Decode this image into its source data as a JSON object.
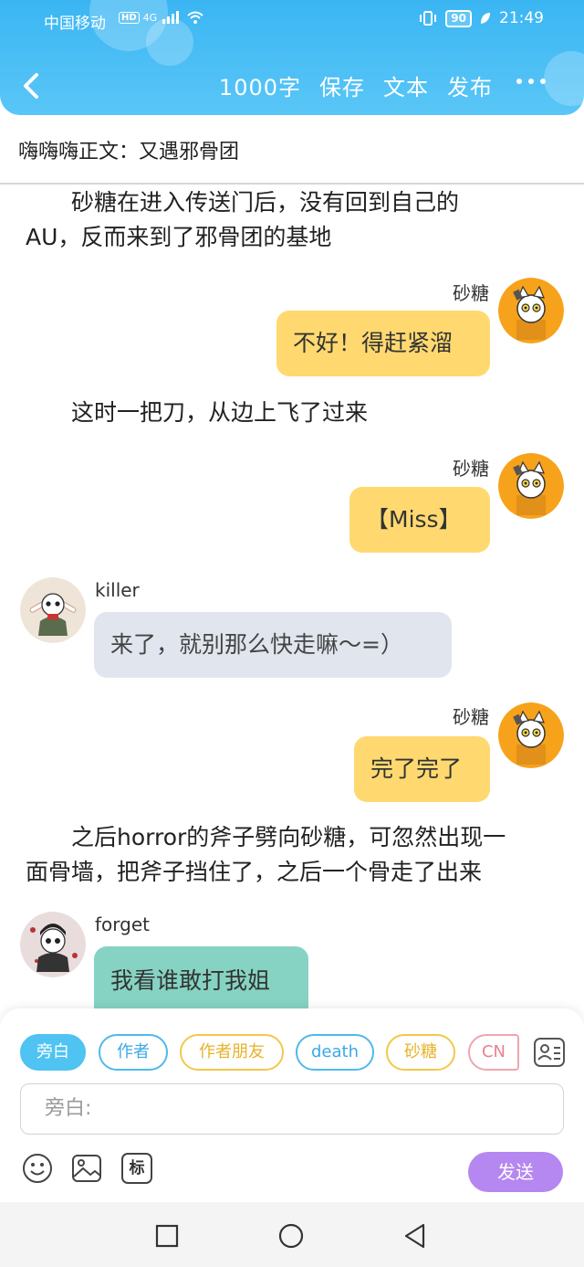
{
  "status_bar": {
    "carrier": "中国移动",
    "hd": "HD",
    "network": "4G",
    "battery": "90",
    "time": "21:49"
  },
  "nav": {
    "word_count": "1000字",
    "save": "保存",
    "text": "文本",
    "publish": "发布"
  },
  "chapter_title": "嗨嗨嗨正文：又遇邪骨团",
  "messages": {
    "n1_line1": "砂糖在进入传送门后，没有回到自己的",
    "n1_line2": "AU，反而来到了邪骨团的基地",
    "m1_name": "砂糖",
    "m1_text": "不好！得赶紧溜",
    "n2": "这时一把刀，从边上飞了过来",
    "m2_name": "砂糖",
    "m2_text": "【Miss】",
    "m3_name": "killer",
    "m3_text": "来了，就别那么快走嘛～=）",
    "m4_name": "砂糖",
    "m4_text": "完了完了",
    "n3_line1": "之后horror的斧子劈向砂糖，可忽然出现一",
    "n3_line2": "面骨墙，把斧子挡住了，之后一个骨走了出来",
    "m5_name": "forget",
    "m5_text": "我看谁敢打我姐"
  },
  "roles": [
    "旁白",
    "作者",
    "作者朋友",
    "death",
    "砂糖",
    "CN"
  ],
  "input": {
    "placeholder": "旁白:"
  },
  "tools": {
    "tag_label": "标",
    "send": "发送"
  },
  "colors": {
    "header": "#3ab6f3",
    "bubble_self": "#ffd970",
    "bubble_killer": "#e1e6ee",
    "bubble_forget": "#86d3c3",
    "send_button": "#b587f0"
  }
}
